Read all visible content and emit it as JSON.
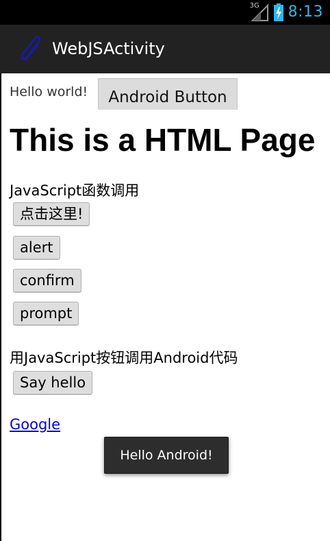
{
  "status_bar": {
    "network": "3G",
    "time": "8:13",
    "signal_icon": "signal-icon",
    "battery_icon": "battery-charging-icon",
    "clock_color": "#33b5e5"
  },
  "action_bar": {
    "title": "WebJSActivity",
    "icon": "paperclip-icon",
    "icon_color": "#1a1aa0"
  },
  "native": {
    "hello_text": "Hello world!",
    "android_button": "Android Button"
  },
  "web": {
    "heading": "This is a HTML Page",
    "js_label": "JavaScript函数调用",
    "buttons": [
      "点击这里!",
      "alert",
      "confirm",
      "prompt"
    ],
    "android_label": "用JavaScript按钮调用Android代码",
    "say_hello": "Say hello",
    "link": "Google",
    "link_color": "#0000ee"
  },
  "toast": {
    "message": "Hello Android!"
  }
}
